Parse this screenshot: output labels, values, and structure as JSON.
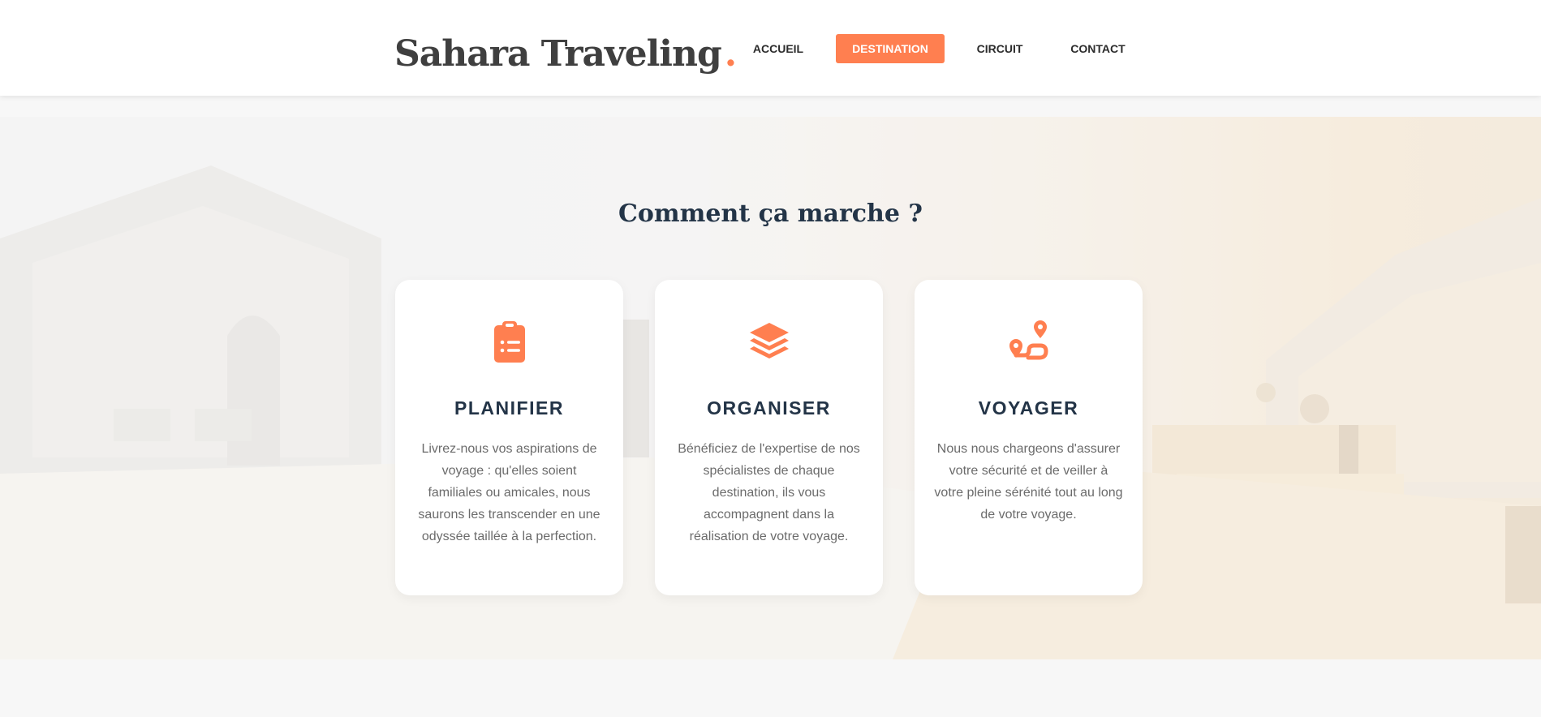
{
  "header": {
    "brand": "Sahara Traveling",
    "brand_dot": ".",
    "nav": {
      "accueil": "ACCUEIL",
      "destination": "DESTINATION",
      "circuit": "CIRCUIT",
      "contact": "CONTACT"
    },
    "active_item": "DESTINATION"
  },
  "section": {
    "title": "Comment ça marche ?",
    "cards": [
      {
        "icon": "clipboard-list-icon",
        "title": "PLANIFIER",
        "text": "Livrez-nous vos aspirations de voyage : qu'elles soient familiales ou amicales, nous saurons les transcender en une odyssée taillée à la perfection."
      },
      {
        "icon": "layers-icon",
        "title": "ORGANISER",
        "text": "Bénéficiez de l'expertise de nos spécialistes de chaque destination, ils vous accompagnent dans la réalisation de votre voyage."
      },
      {
        "icon": "route-icon",
        "title": "VOYAGER",
        "text": "Nous nous chargeons d'assurer votre sécurité et de veiller à votre pleine sérénité tout au long de votre voyage."
      }
    ]
  },
  "colors": {
    "accent": "#ff7f50",
    "heading": "#233447",
    "body_text": "#6b6b6b",
    "logo": "#3f3f3f",
    "page_background": "#f7f7f7"
  }
}
